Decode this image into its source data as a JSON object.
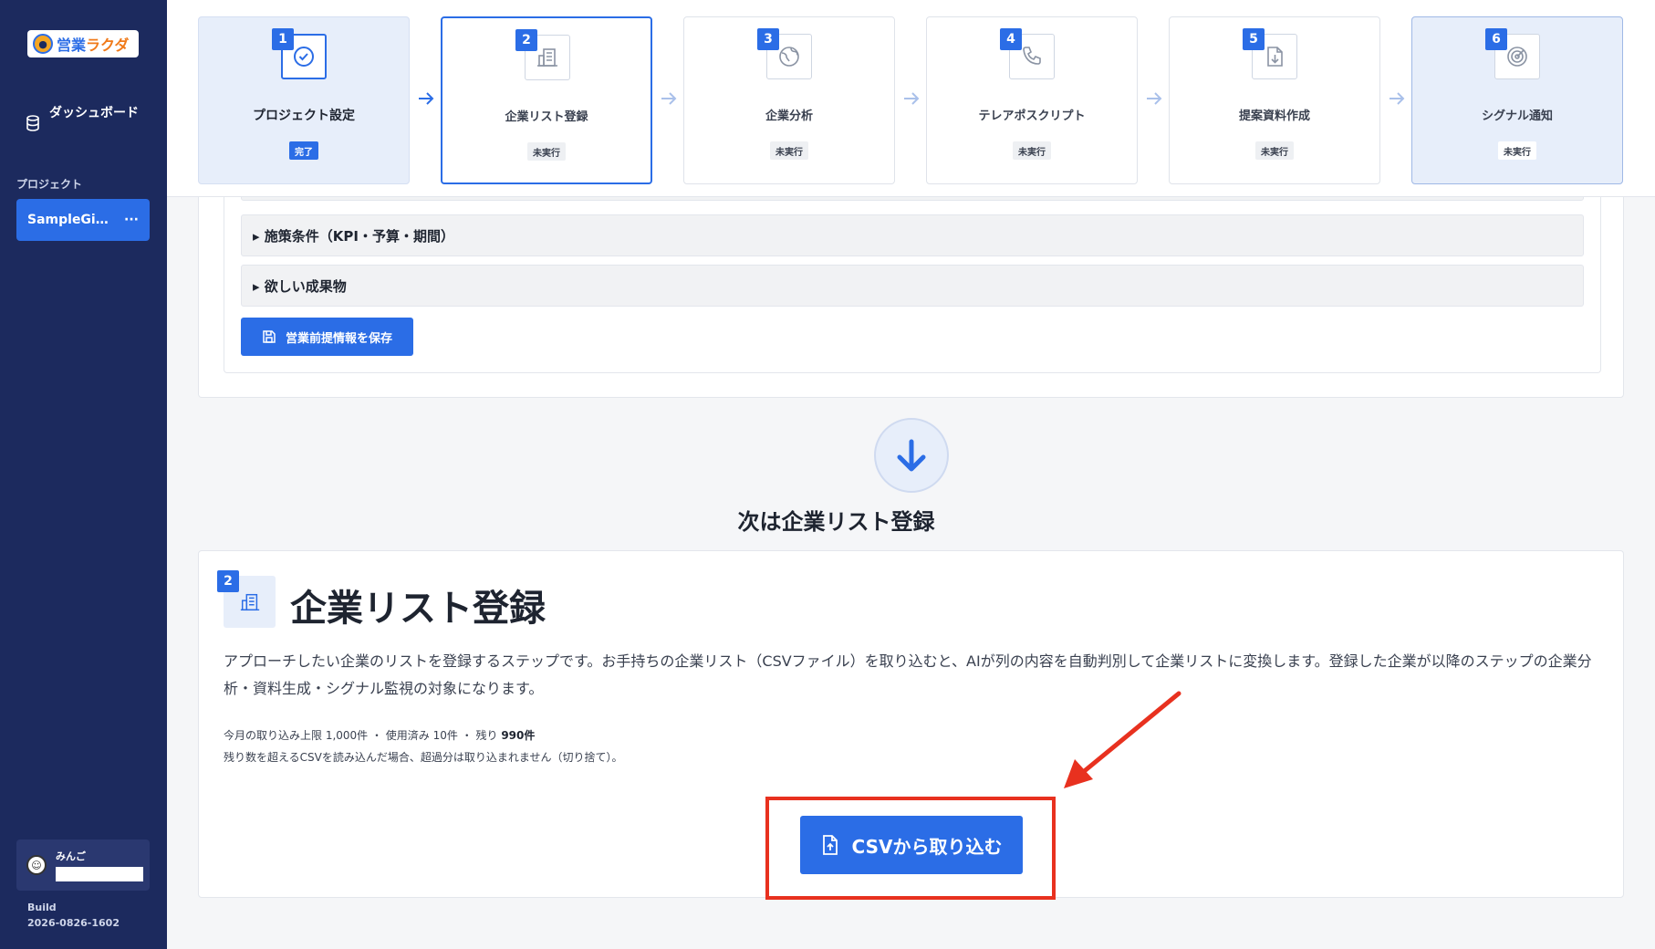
{
  "sidebar": {
    "logo": {
      "prefix": "営業",
      "accent": "ラクダ"
    },
    "nav": {
      "dashboard_label": "ダッシュボード"
    },
    "projects_label": "プロジェクト",
    "project_name": "SampleGi…",
    "project_menu": "···",
    "user": {
      "name": "みんご",
      "avatar": "☺"
    },
    "build_label": "Build",
    "build_number": "2026-0826-1602"
  },
  "stepper": {
    "steps": [
      {
        "num": "1",
        "title": "プロジェクト設定",
        "status": "完了",
        "icon": "check-circle-icon"
      },
      {
        "num": "2",
        "title": "企業リスト登録",
        "status": "未実行",
        "icon": "building-icon"
      },
      {
        "num": "3",
        "title": "企業分析",
        "status": "未実行",
        "icon": "globe-icon"
      },
      {
        "num": "4",
        "title": "テレアポスクリプト",
        "status": "未実行",
        "icon": "phone-icon"
      },
      {
        "num": "5",
        "title": "提案資料作成",
        "status": "未実行",
        "icon": "file-download-icon"
      },
      {
        "num": "6",
        "title": "シグナル通知",
        "status": "未実行",
        "icon": "radar-icon"
      }
    ]
  },
  "upper": {
    "accordion_kpi": "▸ 施策条件（KPI・予算・期間）",
    "accordion_deliverables": "▸ 欲しい成果物",
    "save_button": "営業前提情報を保存"
  },
  "next": {
    "label": "次は企業リスト登録"
  },
  "list_card": {
    "num": "2",
    "title": "企業リスト登録",
    "description": "アプローチしたい企業のリストを登録するステップです。お手持ちの企業リスト（CSVファイル）を取り込むと、AIが列の内容を自動判別して企業リストに変換します。登録した企業が以降のステップの企業分析・資料生成・シグナル監視の対象になります。",
    "quota_prefix": "今月の取り込み上限 1,000件 ・ 使用済み 10件 ・ 残り ",
    "quota_remaining": "990件",
    "quota_note": "残り数を超えるCSVを読み込んだ場合、超過分は取り込まれません（切り捨て）。",
    "csv_button": "CSVから取り込む"
  },
  "colors": {
    "accent": "#2b6de6",
    "sidebar": "#1c2a5e",
    "annotation": "#e8311f"
  }
}
